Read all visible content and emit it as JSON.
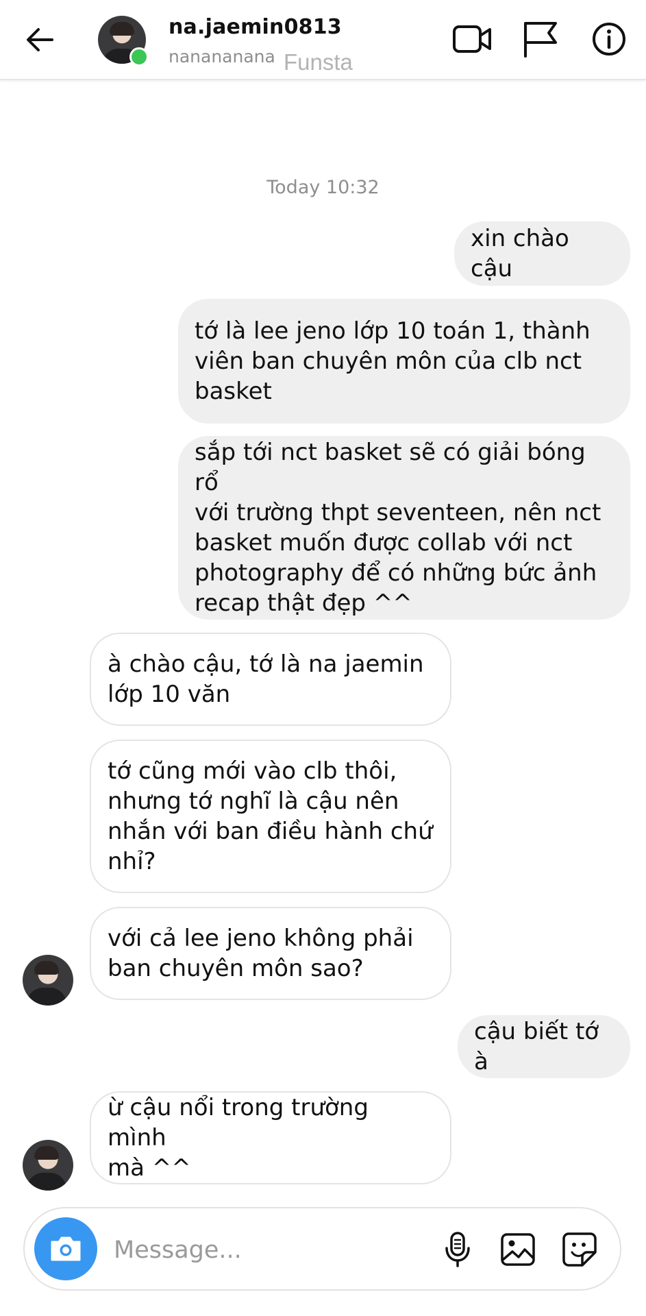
{
  "header": {
    "username": "na.jaemin0813",
    "subname": "nanananana",
    "tag": "Funsta"
  },
  "chat": {
    "timestamp": "Today 10:32",
    "messages": [
      {
        "from": "me",
        "text": "xin chào cậu"
      },
      {
        "from": "me",
        "text": "tớ là lee jeno lớp 10 toán 1, thành\nviên ban chuyên môn của clb nct\nbasket"
      },
      {
        "from": "me",
        "text": "sắp tới nct basket sẽ có giải bóng rổ\nvới trường thpt seventeen, nên nct\nbasket muốn được collab với nct\nphotography để có những bức ảnh\nrecap thật đẹp ^^"
      },
      {
        "from": "them",
        "text": "à chào cậu, tớ là na jaemin\nlớp 10 văn"
      },
      {
        "from": "them",
        "text": "tớ cũng mới vào clb thôi,\nnhưng tớ nghĩ là cậu nên\nnhắn với ban điều hành chứ\nnhỉ?"
      },
      {
        "from": "them",
        "text": "với cả lee jeno không phải\nban chuyên môn sao?"
      },
      {
        "from": "me",
        "text": "cậu biết tớ à"
      },
      {
        "from": "them",
        "text": "ừ cậu nổi trong trường mình\nmà ^^"
      }
    ]
  },
  "composer": {
    "placeholder": "Message..."
  },
  "icons": {
    "back": "arrow-left-icon",
    "video": "video-camera-icon",
    "report": "flag-icon",
    "info": "info-icon",
    "camera": "camera-icon",
    "mic": "microphone-icon",
    "gallery": "image-icon",
    "sticker": "sticker-icon"
  },
  "colors": {
    "online": "#3cc655",
    "camera_button": "#3897f0",
    "outgoing_bubble": "#efefef",
    "incoming_border": "#e4e4e4"
  }
}
